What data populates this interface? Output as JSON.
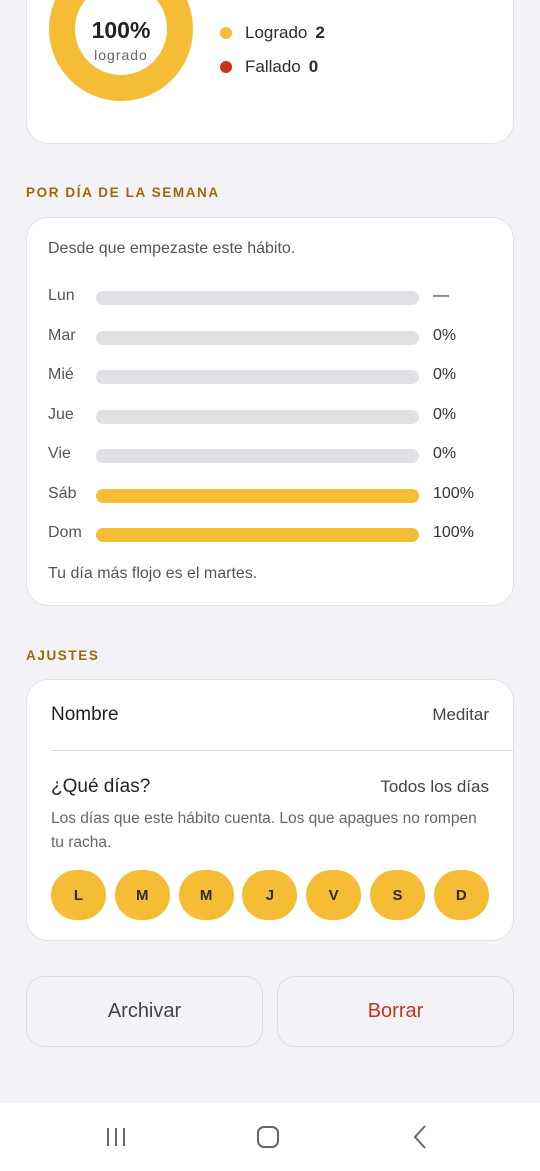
{
  "theme": {
    "accent": "#f5bd36",
    "fail": "#c9341b",
    "track": "#e0e0e5"
  },
  "summary": {
    "percent": "100%",
    "percent_label": "logrado",
    "legend": [
      {
        "label": "Logrado",
        "count": "2",
        "color": "#f5bd36"
      },
      {
        "label": "Fallado",
        "count": "0",
        "color": "#c9341b"
      }
    ]
  },
  "weekday": {
    "section_title": "POR DÍA DE LA SEMANA",
    "description": "Desde que empezaste este hábito.",
    "rows": [
      {
        "day": "Lun",
        "value": "—",
        "fill": 0
      },
      {
        "day": "Mar",
        "value": "0%",
        "fill": 0
      },
      {
        "day": "Mié",
        "value": "0%",
        "fill": 0
      },
      {
        "day": "Jue",
        "value": "0%",
        "fill": 0
      },
      {
        "day": "Vie",
        "value": "0%",
        "fill": 0
      },
      {
        "day": "Sáb",
        "value": "100%",
        "fill": 1
      },
      {
        "day": "Dom",
        "value": "100%",
        "fill": 1
      }
    ],
    "insight": "Tu día más flojo es el martes."
  },
  "settings": {
    "section_title": "AJUSTES",
    "name_label": "Nombre",
    "name_value": "Meditar",
    "days_label": "¿Qué días?",
    "days_value": "Todos los días",
    "days_help": "Los días que este hábito cuenta. Los que apagues no rompen tu racha.",
    "day_chips": [
      {
        "letter": "L",
        "active": true
      },
      {
        "letter": "M",
        "active": true
      },
      {
        "letter": "M",
        "active": true
      },
      {
        "letter": "J",
        "active": true
      },
      {
        "letter": "V",
        "active": true
      },
      {
        "letter": "S",
        "active": true
      },
      {
        "letter": "D",
        "active": true
      }
    ]
  },
  "actions": {
    "archive_label": "Archivar",
    "delete_label": "Borrar"
  },
  "navbar": {
    "icons": [
      "recent-apps-icon",
      "home-icon",
      "back-icon"
    ]
  }
}
